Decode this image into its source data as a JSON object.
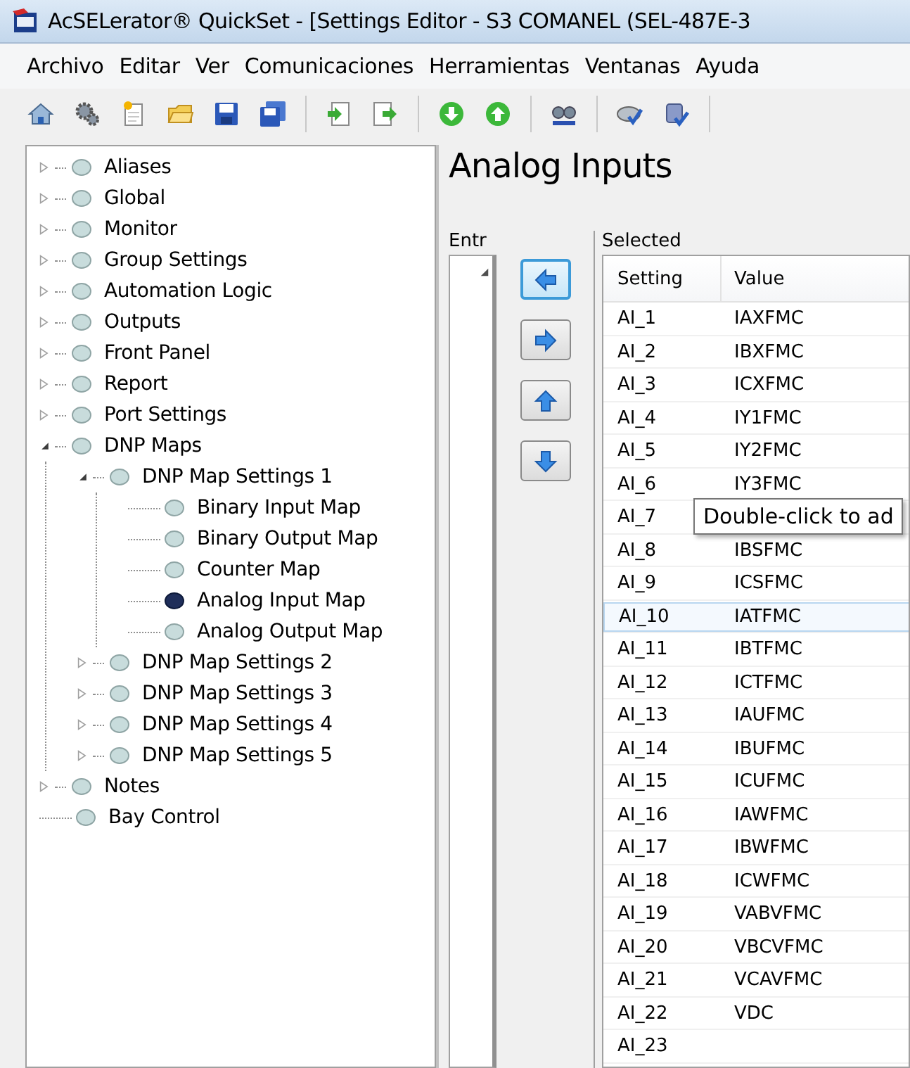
{
  "window": {
    "title": "AcSELerator® QuickSet - [Settings Editor - S3 COMANEL (SEL-487E-3"
  },
  "menu": [
    "Archivo",
    "Editar",
    "Ver",
    "Comunicaciones",
    "Herramientas",
    "Ventanas",
    "Ayuda"
  ],
  "tree": [
    {
      "label": "Aliases",
      "kind": "collapsed",
      "selected": false
    },
    {
      "label": "Global",
      "kind": "collapsed",
      "selected": false
    },
    {
      "label": "Monitor",
      "kind": "collapsed",
      "selected": false
    },
    {
      "label": "Group Settings",
      "kind": "collapsed",
      "selected": false
    },
    {
      "label": "Automation Logic",
      "kind": "collapsed",
      "selected": false
    },
    {
      "label": "Outputs",
      "kind": "collapsed",
      "selected": false
    },
    {
      "label": "Front Panel",
      "kind": "collapsed",
      "selected": false
    },
    {
      "label": "Report",
      "kind": "collapsed",
      "selected": false
    },
    {
      "label": "Port Settings",
      "kind": "collapsed",
      "selected": false
    },
    {
      "label": "DNP Maps",
      "kind": "expanded",
      "selected": false,
      "children": [
        {
          "label": "DNP Map Settings 1",
          "kind": "expanded",
          "selected": false,
          "children": [
            {
              "label": "Binary Input Map",
              "kind": "leaf",
              "selected": false
            },
            {
              "label": "Binary Output Map",
              "kind": "leaf",
              "selected": false
            },
            {
              "label": "Counter Map",
              "kind": "leaf",
              "selected": false
            },
            {
              "label": "Analog Input Map",
              "kind": "leaf",
              "selected": true
            },
            {
              "label": "Analog Output Map",
              "kind": "leaf",
              "selected": false
            }
          ]
        },
        {
          "label": "DNP Map Settings 2",
          "kind": "collapsed",
          "selected": false
        },
        {
          "label": "DNP Map Settings 3",
          "kind": "collapsed",
          "selected": false
        },
        {
          "label": "DNP Map Settings 4",
          "kind": "collapsed",
          "selected": false
        },
        {
          "label": "DNP Map Settings 5",
          "kind": "collapsed",
          "selected": false
        }
      ]
    },
    {
      "label": "Notes",
      "kind": "collapsed",
      "selected": false
    },
    {
      "label": "Bay Control",
      "kind": "leaf",
      "selected": false
    }
  ],
  "panel": {
    "title": "Analog Inputs",
    "entries_label": "Entr",
    "selected_label": "Selected",
    "buttons": [
      {
        "kind": "left",
        "focused": true
      },
      {
        "kind": "right",
        "focused": false
      },
      {
        "kind": "up",
        "focused": false
      },
      {
        "kind": "down",
        "focused": false
      }
    ],
    "table": {
      "columns": [
        "Setting",
        "Value"
      ],
      "rows": [
        {
          "setting": "AI_1",
          "value": "IAXFMC",
          "selected": false
        },
        {
          "setting": "AI_2",
          "value": "IBXFMC",
          "selected": false
        },
        {
          "setting": "AI_3",
          "value": "ICXFMC",
          "selected": false
        },
        {
          "setting": "AI_4",
          "value": "IY1FMC",
          "selected": false
        },
        {
          "setting": "AI_5",
          "value": "IY2FMC",
          "selected": false
        },
        {
          "setting": "AI_6",
          "value": "IY3FMC",
          "selected": false
        },
        {
          "setting": "AI_7",
          "selected": false
        },
        {
          "setting": "AI_8",
          "value": "IBSFMC",
          "selected": false
        },
        {
          "setting": "AI_9",
          "value": "ICSFMC",
          "selected": false
        },
        {
          "setting": "AI_10",
          "value": "IATFMC",
          "selected": true
        },
        {
          "setting": "AI_11",
          "value": "IBTFMC",
          "selected": false
        },
        {
          "setting": "AI_12",
          "value": "ICTFMC",
          "selected": false
        },
        {
          "setting": "AI_13",
          "value": "IAUFMC",
          "selected": false
        },
        {
          "setting": "AI_14",
          "value": "IBUFMC",
          "selected": false
        },
        {
          "setting": "AI_15",
          "value": "ICUFMC",
          "selected": false
        },
        {
          "setting": "AI_16",
          "value": "IAWFMC",
          "selected": false
        },
        {
          "setting": "AI_17",
          "value": "IBWFMC",
          "selected": false
        },
        {
          "setting": "AI_18",
          "value": "ICWFMC",
          "selected": false
        },
        {
          "setting": "AI_19",
          "value": "VABVFMC",
          "selected": false
        },
        {
          "setting": "AI_20",
          "value": "VBCVFMC",
          "selected": false
        },
        {
          "setting": "AI_21",
          "value": "VCAVFMC",
          "selected": false
        },
        {
          "setting": "AI_22",
          "value": "VDC",
          "selected": false
        },
        {
          "setting": "AI_23",
          "selected": false
        }
      ]
    },
    "tooltip": "Double-click to ad"
  }
}
